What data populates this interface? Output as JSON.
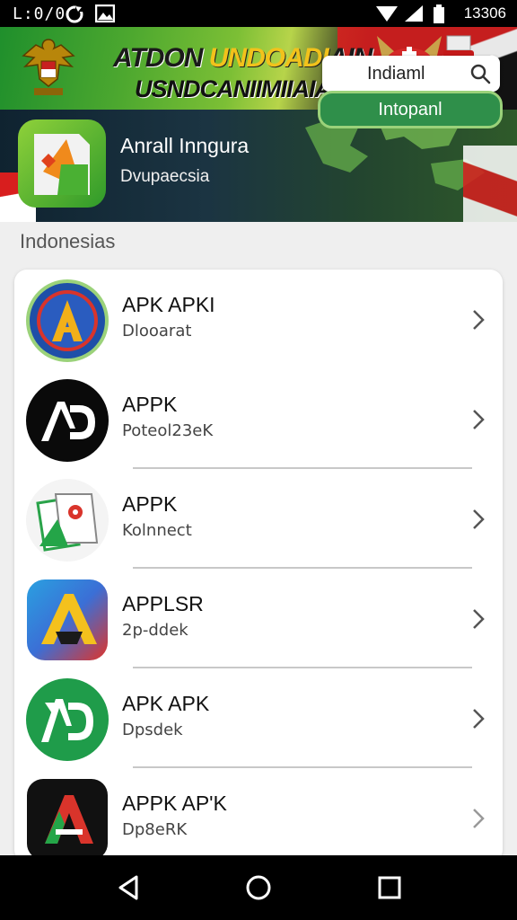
{
  "status_bar": {
    "time": "L:0/0",
    "clock": "13306",
    "icons": [
      "sync-icon",
      "image-icon",
      "wifi-icon",
      "signal-icon",
      "battery-icon"
    ]
  },
  "banner": {
    "headline_part1": "ATDON ",
    "headline_part2": "UNDOADI",
    "headline_part3": "AIN",
    "subheadline": "USNDCANIIMIIAIAI"
  },
  "hero": {
    "title": "Anrall Inngura",
    "subtitle": "Dvupaecsia",
    "search_value": "Indiaml",
    "button_label": "Intopanl"
  },
  "section": {
    "title": "Indonesias"
  },
  "apps": [
    {
      "name": "APK APKI",
      "meta": "Dlooarat",
      "icon": "apk-blue-a-icon"
    },
    {
      "name": "APPK",
      "meta": "Poteol23eK",
      "icon": "ad-black-icon"
    },
    {
      "name": "APPK",
      "meta": "Kolnnect",
      "icon": "cards-green-icon"
    },
    {
      "name": "APPLSR",
      "meta": "2p-ddek",
      "icon": "apk-gradient-a-icon"
    },
    {
      "name": "APK APK",
      "meta": "Dpsdek",
      "icon": "ad-green-icon"
    },
    {
      "name": "APPK AP'K",
      "meta": "Dp8eRK",
      "icon": "a-red-green-icon"
    }
  ],
  "colors": {
    "accent_green": "#2f8f4a",
    "flag_red": "#d81e1e",
    "list_bg": "#ffffff"
  }
}
